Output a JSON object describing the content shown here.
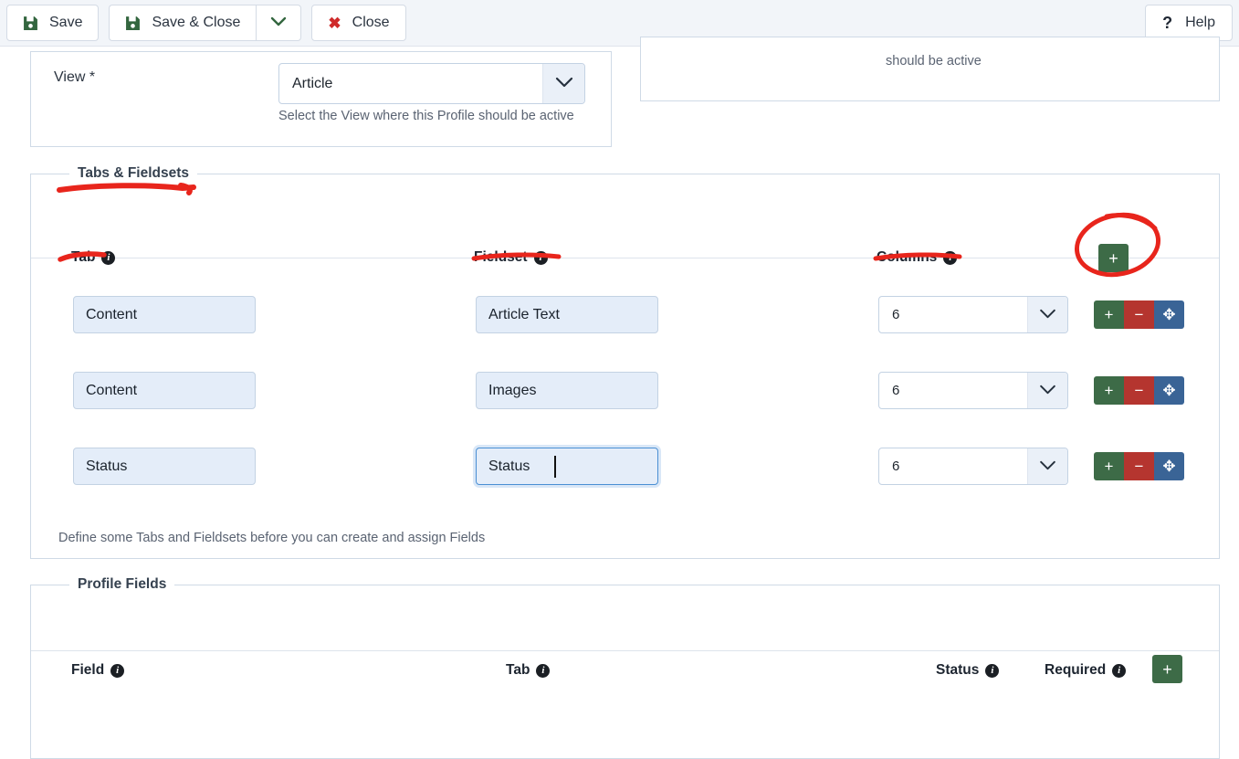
{
  "toolbar": {
    "save_label": "Save",
    "save_close_label": "Save & Close",
    "close_label": "Close",
    "help_label": "Help",
    "save_icon": "floppy-disk-icon",
    "close_icon": "x-icon",
    "caret_icon": "chevron-down-icon",
    "help_icon": "question-mark-icon",
    "bg_color": "#f2f5f9",
    "save_icon_color": "#33663f",
    "close_icon_color": "#cf2b2b"
  },
  "view_panel": {
    "label": "View *",
    "select_value": "Article",
    "select_caret_icon": "chevron-down-icon",
    "help_text": "Select the View where this Profile should be active"
  },
  "right_panel": {
    "text": "should be active"
  },
  "tabs_fieldsets": {
    "legend": "Tabs & Fieldsets",
    "columns": [
      {
        "label": "Tab",
        "info_icon": "info-icon"
      },
      {
        "label": "Fieldset",
        "info_icon": "info-icon"
      },
      {
        "label": "Columns",
        "info_icon": "info-icon"
      }
    ],
    "add_button": {
      "label": "+",
      "icon": "plus-icon",
      "color": "#3d6b47"
    },
    "rows": [
      {
        "tab": "Content",
        "fieldset": "Article Text",
        "columns": "6",
        "focused": false,
        "actions": [
          {
            "name": "add-row-button",
            "label": "+",
            "icon": "plus-icon",
            "color": "#3d6b47"
          },
          {
            "name": "remove-row-button",
            "label": "−",
            "icon": "minus-icon",
            "color": "#b5352f"
          },
          {
            "name": "move-row-handle",
            "label": "✥",
            "icon": "move-arrows-icon",
            "color": "#3a6496"
          }
        ]
      },
      {
        "tab": "Content",
        "fieldset": "Images",
        "columns": "6",
        "focused": false,
        "actions": [
          {
            "name": "add-row-button",
            "label": "+",
            "icon": "plus-icon",
            "color": "#3d6b47"
          },
          {
            "name": "remove-row-button",
            "label": "−",
            "icon": "minus-icon",
            "color": "#b5352f"
          },
          {
            "name": "move-row-handle",
            "label": "✥",
            "icon": "move-arrows-icon",
            "color": "#3a6496"
          }
        ]
      },
      {
        "tab": "Status",
        "fieldset": "Status",
        "columns": "6",
        "focused": true,
        "actions": [
          {
            "name": "add-row-button",
            "label": "+",
            "icon": "plus-icon",
            "color": "#3d6b47"
          },
          {
            "name": "remove-row-button",
            "label": "−",
            "icon": "minus-icon",
            "color": "#b5352f"
          },
          {
            "name": "move-row-handle",
            "label": "✥",
            "icon": "move-arrows-icon",
            "color": "#3a6496"
          }
        ]
      }
    ],
    "hint": "Define some Tabs and Fieldsets before you can create and assign Fields"
  },
  "profile_fields": {
    "legend": "Profile Fields",
    "columns": [
      {
        "label": "Field",
        "info_icon": "info-icon"
      },
      {
        "label": "Tab",
        "info_icon": "info-icon"
      },
      {
        "label": "Status",
        "info_icon": "info-icon"
      },
      {
        "label": "Required",
        "info_icon": "info-icon"
      }
    ],
    "add_button": {
      "label": "+",
      "icon": "plus-icon",
      "color": "#3d6b47"
    }
  },
  "annotations": {
    "color": "#e8251c",
    "marks": [
      "underline-tabs-fieldsets-legend",
      "underline-tab-header",
      "underline-fieldset-header",
      "underline-columns-header",
      "ellipse-around-add-row-button"
    ]
  }
}
